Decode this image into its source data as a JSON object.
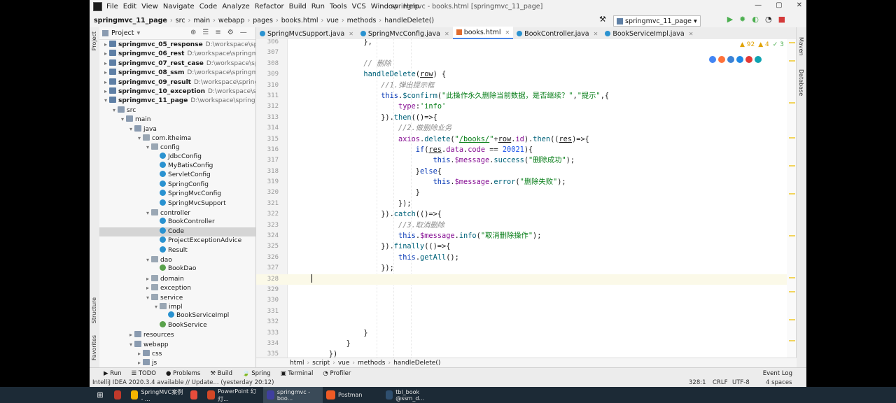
{
  "window": {
    "title": "springmvc - books.html [springmvc_11_page]",
    "controls": [
      "—",
      "▢",
      "✕"
    ]
  },
  "menu": [
    "File",
    "Edit",
    "View",
    "Navigate",
    "Code",
    "Analyze",
    "Refactor",
    "Build",
    "Run",
    "Tools",
    "VCS",
    "Window",
    "Help"
  ],
  "breadcrumb": [
    "springmvc_11_page",
    "src",
    "main",
    "webapp",
    "pages",
    "books.html",
    "vue",
    "methods",
    "handleDelete()"
  ],
  "run_config": "springmvc_11_page",
  "project_panel": {
    "title": "Project"
  },
  "left_strip": {
    "top": "Project",
    "structure": "Structure",
    "favorites": "Favorites"
  },
  "right_strip": {
    "maven": "Maven",
    "database": "Database"
  },
  "tree": [
    {
      "label": "springmvc_05_response",
      "path": "D:\\workspace\\springmvc\\springmvc_05_response",
      "indent": 0,
      "arrow": "▸",
      "icon": "mod",
      "bold": true
    },
    {
      "label": "springmvc_06_rest",
      "path": "D:\\workspace\\springmvc\\springmvc_06_rest",
      "indent": 0,
      "arrow": "▸",
      "icon": "mod",
      "bold": true
    },
    {
      "label": "springmvc_07_rest_case",
      "path": "D:\\workspace\\springmvc\\springmvc_07_rest_case",
      "indent": 0,
      "arrow": "▸",
      "icon": "mod",
      "bold": true
    },
    {
      "label": "springmvc_08_ssm",
      "path": "D:\\workspace\\springmvc\\springmvc_08_ssm",
      "indent": 0,
      "arrow": "▸",
      "icon": "mod",
      "bold": true
    },
    {
      "label": "springmvc_09_result",
      "path": "D:\\workspace\\springmvc\\springmvc_09_result",
      "indent": 0,
      "arrow": "▸",
      "icon": "mod",
      "bold": true
    },
    {
      "label": "springmvc_10_exception",
      "path": "D:\\workspace\\springmvc\\springmvc_10_exception",
      "indent": 0,
      "arrow": "▸",
      "icon": "mod",
      "bold": true
    },
    {
      "label": "springmvc_11_page",
      "path": "D:\\workspace\\springmvc\\springmvc_11_page",
      "indent": 0,
      "arrow": "▾",
      "icon": "mod",
      "bold": true
    },
    {
      "label": "src",
      "path": "",
      "indent": 1,
      "arrow": "▾",
      "icon": "folder"
    },
    {
      "label": "main",
      "path": "",
      "indent": 2,
      "arrow": "▾",
      "icon": "folder"
    },
    {
      "label": "java",
      "path": "",
      "indent": 3,
      "arrow": "▾",
      "icon": "folder"
    },
    {
      "label": "com.itheima",
      "path": "",
      "indent": 4,
      "arrow": "▾",
      "icon": "pkg"
    },
    {
      "label": "config",
      "path": "",
      "indent": 5,
      "arrow": "▾",
      "icon": "pkg"
    },
    {
      "label": "JdbcConfig",
      "path": "",
      "indent": 6,
      "arrow": "",
      "icon": "cls"
    },
    {
      "label": "MyBatisConfig",
      "path": "",
      "indent": 6,
      "arrow": "",
      "icon": "cls"
    },
    {
      "label": "ServletConfig",
      "path": "",
      "indent": 6,
      "arrow": "",
      "icon": "cls"
    },
    {
      "label": "SpringConfig",
      "path": "",
      "indent": 6,
      "arrow": "",
      "icon": "cls"
    },
    {
      "label": "SpringMvcConfig",
      "path": "",
      "indent": 6,
      "arrow": "",
      "icon": "cls"
    },
    {
      "label": "SpringMvcSupport",
      "path": "",
      "indent": 6,
      "arrow": "",
      "icon": "cls"
    },
    {
      "label": "controller",
      "path": "",
      "indent": 5,
      "arrow": "▾",
      "icon": "pkg"
    },
    {
      "label": "BookController",
      "path": "",
      "indent": 6,
      "arrow": "",
      "icon": "cls"
    },
    {
      "label": "Code",
      "path": "",
      "indent": 6,
      "arrow": "",
      "icon": "cls",
      "selected": true
    },
    {
      "label": "ProjectExceptionAdvice",
      "path": "",
      "indent": 6,
      "arrow": "",
      "icon": "cls"
    },
    {
      "label": "Result",
      "path": "",
      "indent": 6,
      "arrow": "",
      "icon": "cls"
    },
    {
      "label": "dao",
      "path": "",
      "indent": 5,
      "arrow": "▾",
      "icon": "pkg"
    },
    {
      "label": "BookDao",
      "path": "",
      "indent": 6,
      "arrow": "",
      "icon": "itf"
    },
    {
      "label": "domain",
      "path": "",
      "indent": 5,
      "arrow": "▸",
      "icon": "pkg"
    },
    {
      "label": "exception",
      "path": "",
      "indent": 5,
      "arrow": "▸",
      "icon": "pkg"
    },
    {
      "label": "service",
      "path": "",
      "indent": 5,
      "arrow": "▾",
      "icon": "pkg"
    },
    {
      "label": "impl",
      "path": "",
      "indent": 6,
      "arrow": "▾",
      "icon": "pkg"
    },
    {
      "label": "BookServiceImpl",
      "path": "",
      "indent": 7,
      "arrow": "",
      "icon": "cls"
    },
    {
      "label": "BookService",
      "path": "",
      "indent": 6,
      "arrow": "",
      "icon": "itf"
    },
    {
      "label": "resources",
      "path": "",
      "indent": 3,
      "arrow": "▸",
      "icon": "folder"
    },
    {
      "label": "webapp",
      "path": "",
      "indent": 3,
      "arrow": "▾",
      "icon": "folder"
    },
    {
      "label": "css",
      "path": "",
      "indent": 4,
      "arrow": "▸",
      "icon": "folder"
    },
    {
      "label": "js",
      "path": "",
      "indent": 4,
      "arrow": "▸",
      "icon": "folder"
    }
  ],
  "tabs": [
    {
      "label": "SpringMvcSupport.java",
      "icon": "ci",
      "active": false
    },
    {
      "label": "SpringMvcConfig.java",
      "icon": "ci",
      "active": false
    },
    {
      "label": "books.html",
      "icon": "hi",
      "active": true
    },
    {
      "label": "BookController.java",
      "icon": "ci",
      "active": false
    },
    {
      "label": "BookServiceImpl.java",
      "icon": "ci",
      "active": false
    }
  ],
  "inspections": {
    "warnings": "▲ 92",
    "weak": "▲ 4",
    "ok": "✓ 3"
  },
  "code_lines": [
    {
      "n": "306",
      "html": "            },"
    },
    {
      "n": "307",
      "html": ""
    },
    {
      "n": "308",
      "html": "            <span class='cm'>// 删除</span>"
    },
    {
      "n": "309",
      "html": "            <span class='fn'>handleDelete</span>(<span class='ul'>row</span>) {"
    },
    {
      "n": "310",
      "html": "                <span class='cm'>//1.弹出提示框</span>"
    },
    {
      "n": "311",
      "html": "                <span class='kw'>this</span>.<span class='fn'>$confirm</span>(<span class='str'>\"此操作永久删除当前数据，是否继续？\"</span>,<span class='str'>\"提示\"</span>,{"
    },
    {
      "n": "312",
      "html": "                    <span class='prop'>type</span>:<span class='str'>'info'</span>"
    },
    {
      "n": "313",
      "html": "                }).<span class='fn'>then</span>(()=>{"
    },
    {
      "n": "314",
      "html": "                    <span class='cm'>//2.做删除业务</span>"
    },
    {
      "n": "315",
      "html": "                    <span class='prop'>axios</span>.<span class='fn'>delete</span>(<span class='str'>\"<span class='ul'>/books/</span>\"</span>+<span class='ul'>row</span>.<span class='prop'>id</span>).<span class='fn'>then</span>((<span class='ul'>res</span>)=>{"
    },
    {
      "n": "316",
      "html": "                        <span class='kw'>if</span>(<span class='ul'>res</span>.<span class='prop'>data</span>.<span class='prop'>code</span> == <span class='num'>20021</span>){"
    },
    {
      "n": "317",
      "html": "                            <span class='kw'>this</span>.<span class='prop'>$message</span>.<span class='fn'>success</span>(<span class='str'>\"删除成功\"</span>);"
    },
    {
      "n": "318",
      "html": "                        }<span class='kw'>else</span>{"
    },
    {
      "n": "319",
      "html": "                            <span class='kw'>this</span>.<span class='prop'>$message</span>.<span class='fn'>error</span>(<span class='str'>\"删除失败\"</span>);"
    },
    {
      "n": "320",
      "html": "                        }"
    },
    {
      "n": "321",
      "html": "                    });"
    },
    {
      "n": "322",
      "html": "                }).<span class='fn'>catch</span>(()=>{"
    },
    {
      "n": "323",
      "html": "                    <span class='cm'>//3.取消删除</span>"
    },
    {
      "n": "324",
      "html": "                    <span class='kw'>this</span>.<span class='prop'>$message</span>.<span class='fn'>info</span>(<span class='str'>\"取消删除操作\"</span>);"
    },
    {
      "n": "325",
      "html": "                }).<span class='fn'>finally</span>(()=>{"
    },
    {
      "n": "326",
      "html": "                    <span class='kw'>this</span>.<span class='fn'>getAll</span>();"
    },
    {
      "n": "327",
      "html": "                });"
    },
    {
      "n": "328",
      "html": "<span class='caret'></span>",
      "current": true
    },
    {
      "n": "329",
      "html": ""
    },
    {
      "n": "330",
      "html": ""
    },
    {
      "n": "331",
      "html": ""
    },
    {
      "n": "332",
      "html": ""
    },
    {
      "n": "333",
      "html": "            }"
    },
    {
      "n": "334",
      "html": "        }"
    },
    {
      "n": "335",
      "html": "    })"
    }
  ],
  "editor_breadcrumb": [
    "html",
    "script",
    "vue",
    "methods",
    "handleDelete()"
  ],
  "bottom_tools": [
    "▶ Run",
    "☰ TODO",
    "● Problems",
    "⚒ Build",
    "🍃 Spring",
    "▣ Terminal",
    "◔ Profiler"
  ],
  "event_log": "Event Log",
  "status": {
    "message": "IntelliJ IDEA 2020.3.4 available // Update... (yesterday 20:12)",
    "position": "328:1",
    "line_sep": "CRLF",
    "encoding": "UTF-8",
    "indent": "4 spaces"
  },
  "taskbar": [
    {
      "label": "",
      "color": "#c0392b"
    },
    {
      "label": "SpringMVC案例 - ...",
      "color": "#f4b400"
    },
    {
      "label": "",
      "color": "#e74c3c"
    },
    {
      "label": "PowerPoint 幻灯...",
      "color": "#d24726"
    },
    {
      "label": "springmvc - boo...",
      "color": "#3f3f9f",
      "active": true
    },
    {
      "label": "Postman",
      "color": "#ef5b25"
    },
    {
      "label": "tbl_book @ssm_d...",
      "color": "#2f4f6f"
    }
  ]
}
